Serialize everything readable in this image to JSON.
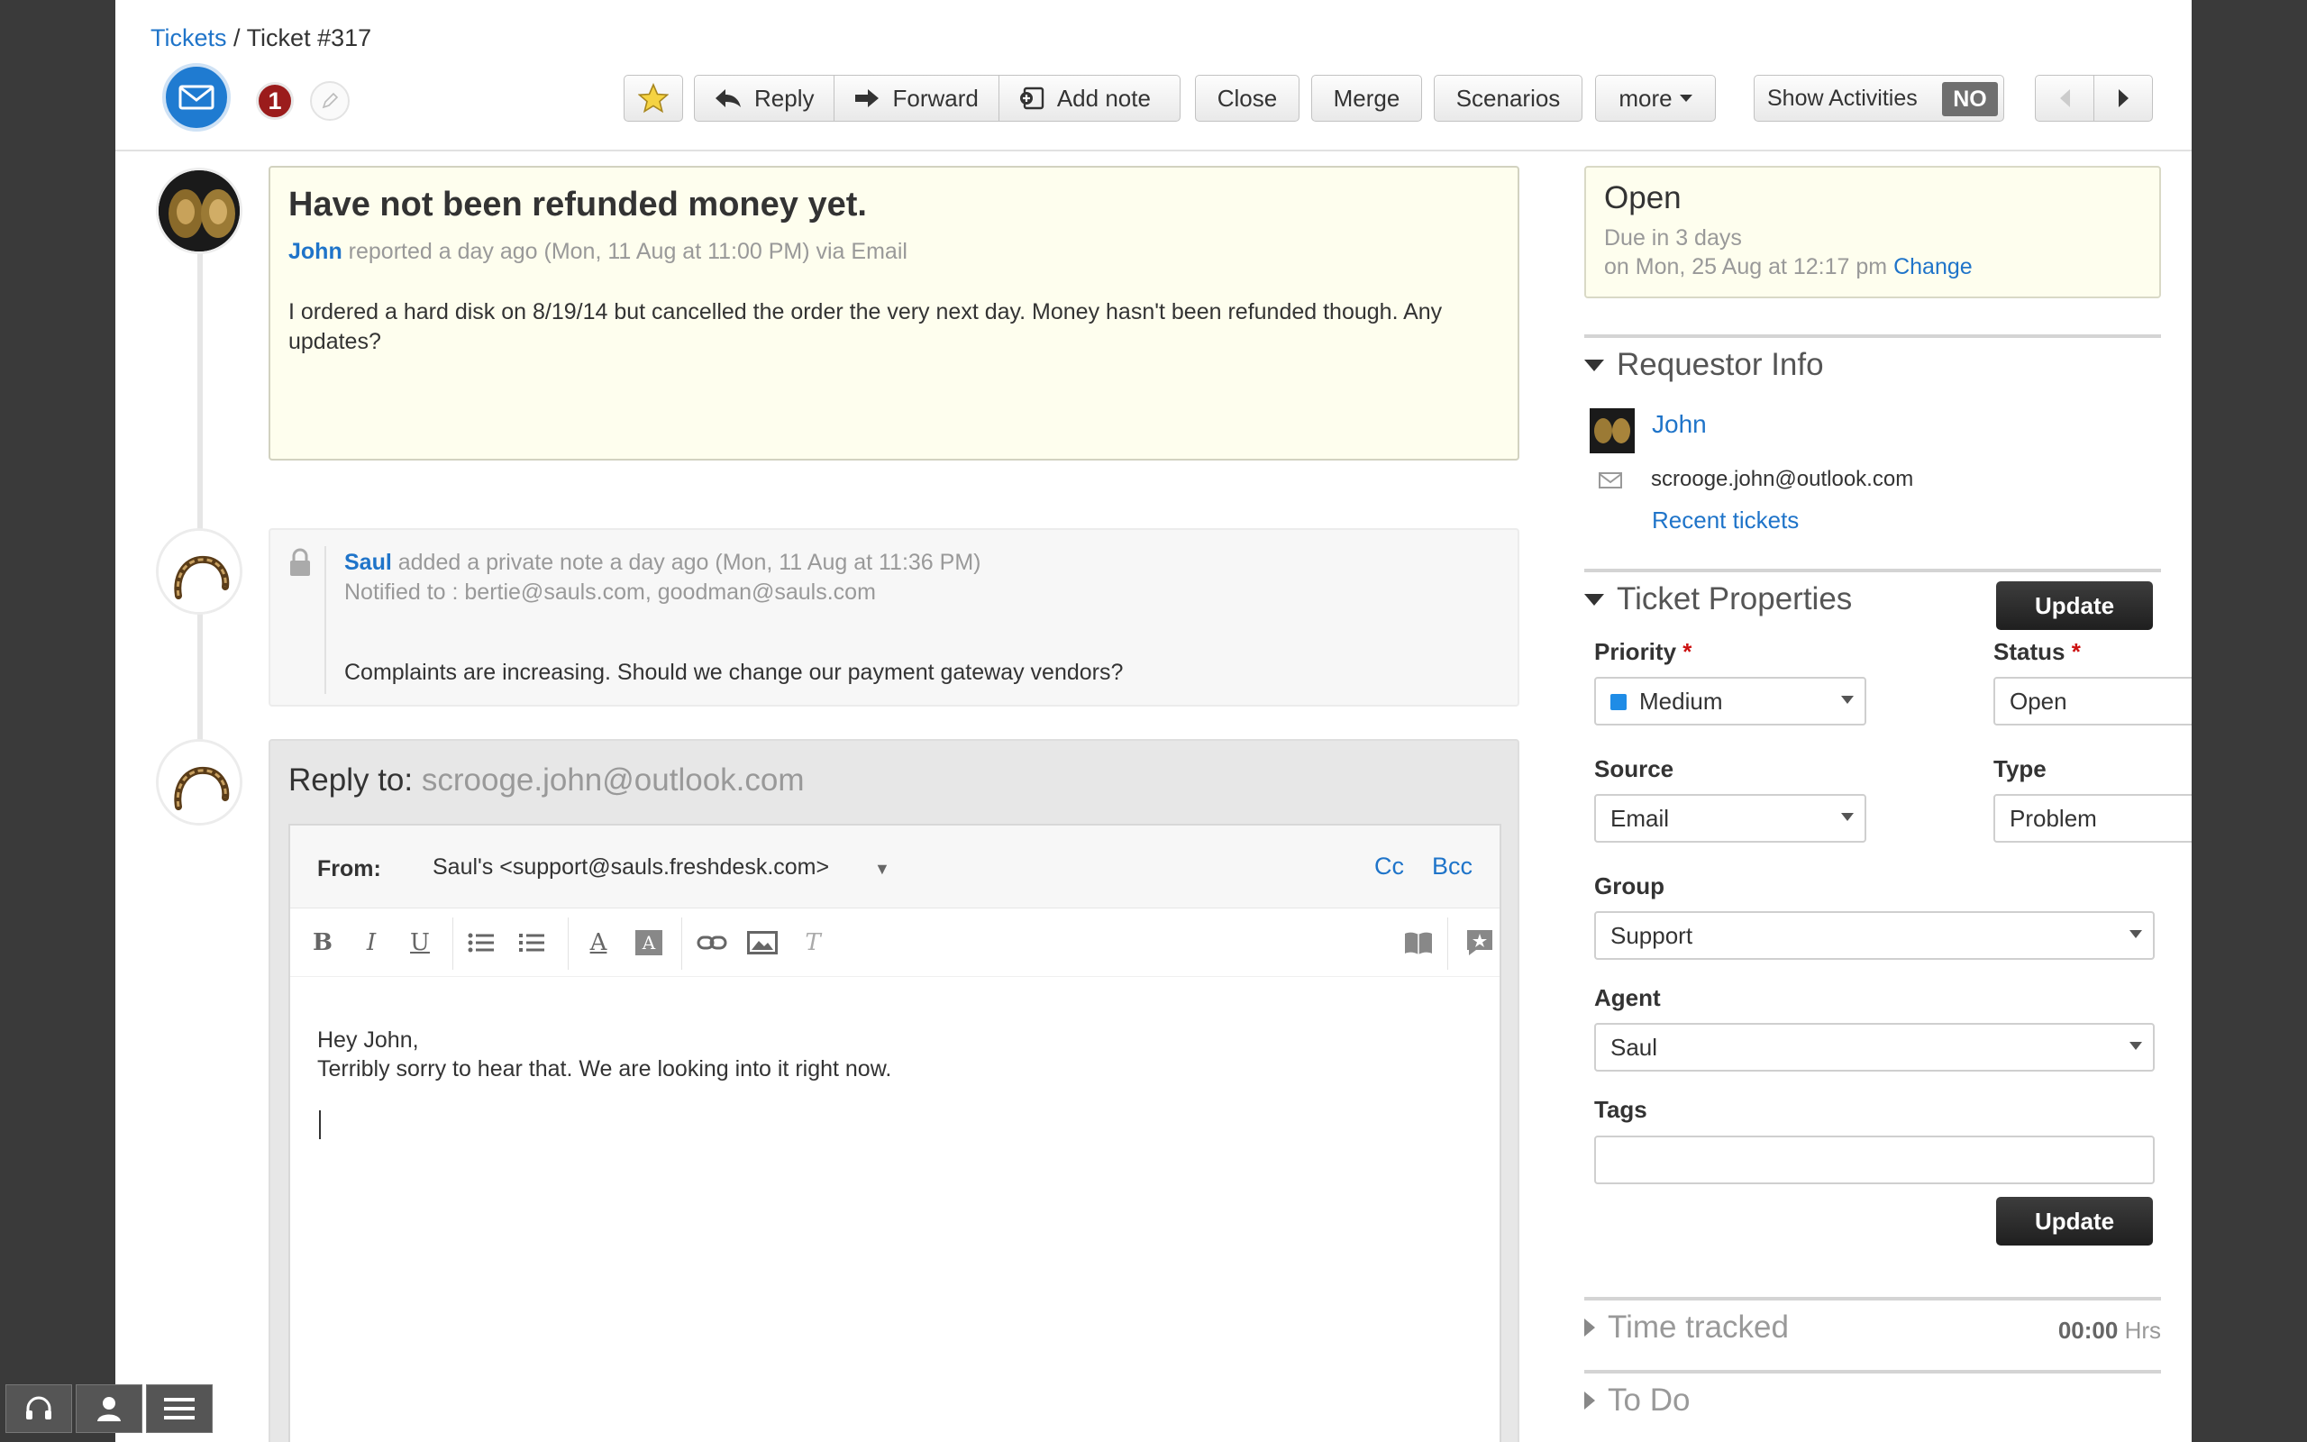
{
  "breadcrumb": {
    "root": "Tickets",
    "sep": "/",
    "current": "Ticket #317"
  },
  "header": {
    "badge_count": "1"
  },
  "toolbar": {
    "reply": "Reply",
    "forward": "Forward",
    "add_note": "Add note",
    "close": "Close",
    "merge": "Merge",
    "scenarios": "Scenarios",
    "more": "more",
    "show_activities": "Show Activities",
    "toggle_state": "NO"
  },
  "ticket": {
    "subject": "Have not been refunded money yet.",
    "requester": "John",
    "reported_meta": "reported a day ago (Mon, 11 Aug at 11:00 PM) via Email",
    "body": "I ordered a hard disk on 8/19/14 but cancelled the order the very next day. Money hasn't been refunded though. Any updates?"
  },
  "note": {
    "author": "Saul",
    "meta": "added a private note a day ago (Mon, 11 Aug at 11:36 PM)",
    "notified": "Notified to : bertie@sauls.com, goodman@sauls.com",
    "message": "Complaints are increasing. Should we change our payment gateway vendors?"
  },
  "reply": {
    "label": "Reply to:",
    "to": "scrooge.john@outlook.com",
    "from_label": "From:",
    "from_value": "Saul's <support@sauls.freshdesk.com>",
    "cc": "Cc",
    "bcc": "Bcc",
    "line1": "Hey John,",
    "line2": "Terribly sorry to hear that. We are looking into it right now."
  },
  "status_box": {
    "status": "Open",
    "due": "Due in 3 days",
    "due_date": "on Mon, 25 Aug at 12:17 pm",
    "change": "Change"
  },
  "requestor": {
    "heading": "Requestor Info",
    "name": "John",
    "email": "scrooge.john@outlook.com",
    "recent": "Recent tickets"
  },
  "properties": {
    "heading": "Ticket Properties",
    "update": "Update",
    "priority_label": "Priority",
    "priority": "Medium",
    "priority_color": "#1f8ce6",
    "status_label": "Status",
    "status": "Open",
    "source_label": "Source",
    "source": "Email",
    "type_label": "Type",
    "type": "Problem",
    "group_label": "Group",
    "group": "Support",
    "agent_label": "Agent",
    "agent": "Saul",
    "tags_label": "Tags",
    "tags": "",
    "required_mark": "*"
  },
  "time_tracked": {
    "label": "Time tracked",
    "value": "00:00",
    "unit": "Hrs"
  },
  "todo": {
    "label": "To Do"
  }
}
